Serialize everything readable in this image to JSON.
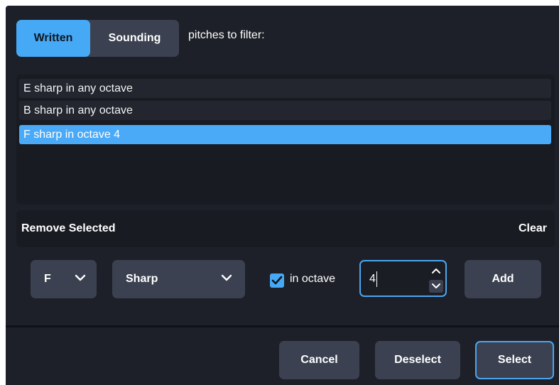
{
  "pitch_mode": {
    "options": [
      "Written",
      "Sounding"
    ],
    "selected": "Written",
    "label": "pitches to filter:"
  },
  "pitch_list": [
    {
      "label": "E sharp in any octave",
      "selected": false
    },
    {
      "label": "B sharp in any octave",
      "selected": false
    },
    {
      "label": "F sharp in octave 4",
      "selected": true
    }
  ],
  "list_actions": {
    "remove_label": "Remove Selected",
    "clear_label": "Clear"
  },
  "pitch_editor": {
    "note": "F",
    "accidental": "Sharp",
    "in_octave_checked": true,
    "in_octave_label": "in octave",
    "octave_value": "4",
    "add_label": "Add"
  },
  "footer": {
    "cancel_label": "Cancel",
    "deselect_label": "Deselect",
    "select_label": "Select"
  },
  "colors": {
    "accent": "#45a9f5",
    "background": "#1d2028",
    "button": "#3b4150",
    "list_bg": "#181b22"
  }
}
